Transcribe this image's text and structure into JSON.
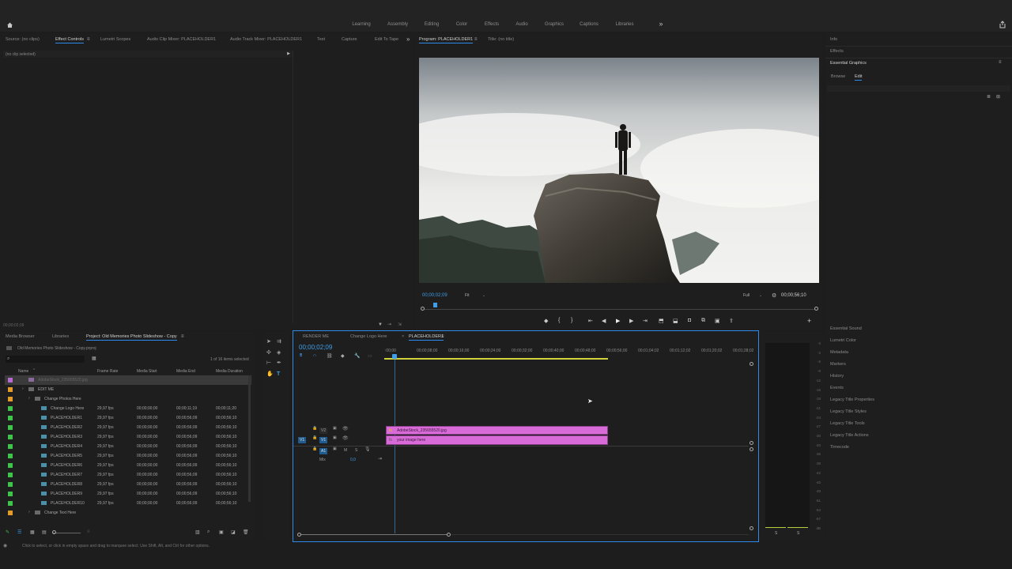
{
  "workspaces": [
    "Learning",
    "Assembly",
    "Editing",
    "Color",
    "Effects",
    "Audio",
    "Graphics",
    "Captions",
    "Libraries"
  ],
  "overflow_glyph": "»",
  "source_panel": {
    "tabs": [
      "Source: (no clips)",
      "Effect Controls",
      "Lumetri Scopes",
      "Audio Clip Mixer: PLACEHOLDER1",
      "Audio Track Mixer: PLACEHOLDER1",
      "Text",
      "Capture",
      "Edit To Tape"
    ],
    "no_clip": "(no clip selected)",
    "timecode": "00;00;02;09"
  },
  "program": {
    "tab": "Program: PLACEHOLDER1",
    "tab2": "Title: (no title)",
    "timecode": "00;00;02;09",
    "fit": "Fit",
    "quality": "Full",
    "duration": "00;00;56;10"
  },
  "right_panels": {
    "top": [
      "Info",
      "Effects",
      "Essential Graphics"
    ],
    "eg_tabs": [
      "Browse",
      "Edit"
    ],
    "list": [
      "Essential Sound",
      "Lumetri Color",
      "Metadata",
      "Markers",
      "History",
      "Events",
      "Legacy Title Properties",
      "Legacy Title Styles",
      "Legacy Title Tools",
      "Legacy Title Actions",
      "Timecode"
    ]
  },
  "project": {
    "tabs": [
      "Media Browser",
      "Libraries",
      "Project: Old Memories Photo Slideshow - Copy"
    ],
    "filename": "Old Memories Photo Slideshow - Copy.prproj",
    "items_count": "1 of 16 items selected",
    "headers": [
      "Name",
      "Frame Rate",
      "Media Start",
      "Media End",
      "Media Duration"
    ],
    "rows": [
      {
        "name": "AdobeStock_235655520.jpg",
        "fps": "",
        "start": "",
        "end": "",
        "dur": "",
        "color": "#b76ad0"
      },
      {
        "name": "EDIT ME",
        "fps": "",
        "start": "",
        "end": "",
        "dur": "",
        "color": "#e59b2a"
      },
      {
        "name": "Change Photos Here",
        "fps": "",
        "start": "",
        "end": "",
        "dur": "",
        "color": "#e59b2a"
      },
      {
        "name": "Change Logo Here",
        "fps": "29,97 fps",
        "start": "00;00;00;00",
        "end": "00;00;11;19",
        "dur": "00;00;11;20",
        "color": "#3ec34b"
      },
      {
        "name": "PLACEHOLDER1",
        "fps": "29,97 fps",
        "start": "00;00;00;00",
        "end": "00;00;56;09",
        "dur": "00;00;56;10",
        "color": "#3ec34b"
      },
      {
        "name": "PLACEHOLDER2",
        "fps": "29,97 fps",
        "start": "00;00;00;00",
        "end": "00;00;56;09",
        "dur": "00;00;56;10",
        "color": "#3ec34b"
      },
      {
        "name": "PLACEHOLDER3",
        "fps": "29,97 fps",
        "start": "00;00;00;00",
        "end": "00;00;56;09",
        "dur": "00;00;56;10",
        "color": "#3ec34b"
      },
      {
        "name": "PLACEHOLDER4",
        "fps": "29,97 fps",
        "start": "00;00;00;00",
        "end": "00;00;56;09",
        "dur": "00;00;56;10",
        "color": "#3ec34b"
      },
      {
        "name": "PLACEHOLDER5",
        "fps": "29,97 fps",
        "start": "00;00;00;00",
        "end": "00;00;56;09",
        "dur": "00;00;56;10",
        "color": "#3ec34b"
      },
      {
        "name": "PLACEHOLDER6",
        "fps": "29,97 fps",
        "start": "00;00;00;00",
        "end": "00;00;56;09",
        "dur": "00;00;56;10",
        "color": "#3ec34b"
      },
      {
        "name": "PLACEHOLDER7",
        "fps": "29,97 fps",
        "start": "00;00;00;00",
        "end": "00;00;56;09",
        "dur": "00;00;56;10",
        "color": "#3ec34b"
      },
      {
        "name": "PLACEHOLDER8",
        "fps": "29,97 fps",
        "start": "00;00;00;00",
        "end": "00;00;56;09",
        "dur": "00;00;56;10",
        "color": "#3ec34b"
      },
      {
        "name": "PLACEHOLDER9",
        "fps": "29,97 fps",
        "start": "00;00;00;00",
        "end": "00;00;56;09",
        "dur": "00;00;56;10",
        "color": "#3ec34b"
      },
      {
        "name": "PLACEHOLDER10",
        "fps": "29,97 fps",
        "start": "00;00;00;00",
        "end": "00;00;56;09",
        "dur": "00;00;56;10",
        "color": "#3ec34b"
      },
      {
        "name": "Change Text Here",
        "fps": "",
        "start": "",
        "end": "",
        "dur": "",
        "color": "#e59b2a"
      }
    ]
  },
  "timeline": {
    "tabs": [
      "RENDER ME",
      "Change Logo Here",
      "PLACEHOLDER1"
    ],
    "close_glyph": "×",
    "timecode": "00;00;02;09",
    "ruler": [
      ":00;00",
      "00;00;08;00",
      "00;00;16;00",
      "00;00;24;00",
      "00;00;32;00",
      "00;00;40;00",
      "00;00;48;00",
      "00;00;56;00",
      "00;01;04;02",
      "00;01;12;02",
      "00;01;20;02",
      "00;01;28;02"
    ],
    "tracks": {
      "v2": "V2",
      "v1": "V1",
      "a1": "A1",
      "src_v1": "V1",
      "mix": "Mix",
      "mix_val": "0,0",
      "m": "M",
      "s": "S"
    },
    "clips": [
      "AdobeStock_235655520.jpg",
      "your image here"
    ],
    "clip_color": "#d96bd9"
  },
  "meter": {
    "scale": [
      "0",
      "-3",
      "-6",
      "-9",
      "-12",
      "-15",
      "-18",
      "-21",
      "-24",
      "-27",
      "-30",
      "-33",
      "-36",
      "-39",
      "-42",
      "-45",
      "-48",
      "-51",
      "-54",
      "-57",
      "dB"
    ],
    "labels": [
      "S",
      "S"
    ]
  },
  "status": "Click to select, or click in empty space and drag to marquee select. Use Shift, Alt, and Ctrl for other options."
}
